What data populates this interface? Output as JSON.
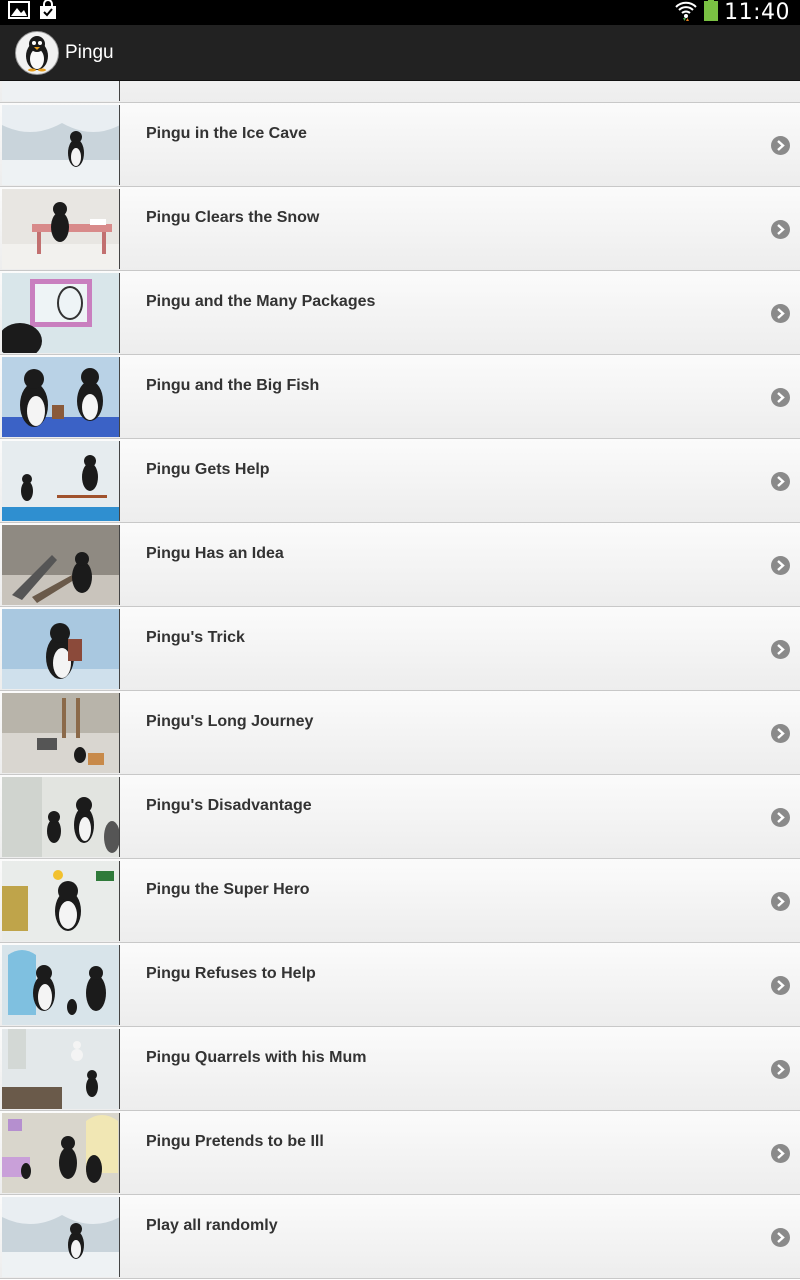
{
  "status_bar": {
    "time": "11:40",
    "icons": [
      "gallery-icon",
      "shopping-bag-icon",
      "wifi-icon",
      "battery-icon"
    ]
  },
  "action_bar": {
    "title": "Pingu",
    "app_icon": "penguin-logo-icon"
  },
  "colors": {
    "action_bar": "#222222",
    "status_bar": "#000000",
    "row_top": "#fbfbfb",
    "row_bottom": "#ededed",
    "title_text": "#333333",
    "chevron": "#8a8a8a"
  },
  "list": {
    "items": [
      {
        "title": "Pingu in the Ice Cave"
      },
      {
        "title": "Pingu Clears the Snow"
      },
      {
        "title": "Pingu and the Many Packages"
      },
      {
        "title": "Pingu and the Big Fish"
      },
      {
        "title": "Pingu Gets Help"
      },
      {
        "title": "Pingu Has an Idea"
      },
      {
        "title": "Pingu's Trick"
      },
      {
        "title": "Pingu's Long Journey"
      },
      {
        "title": "Pingu's Disadvantage"
      },
      {
        "title": "Pingu the Super Hero"
      },
      {
        "title": "Pingu Refuses to Help"
      },
      {
        "title": "Pingu Quarrels with his Mum"
      },
      {
        "title": "Pingu Pretends to be Ill"
      },
      {
        "title": "Play all randomly"
      }
    ]
  }
}
